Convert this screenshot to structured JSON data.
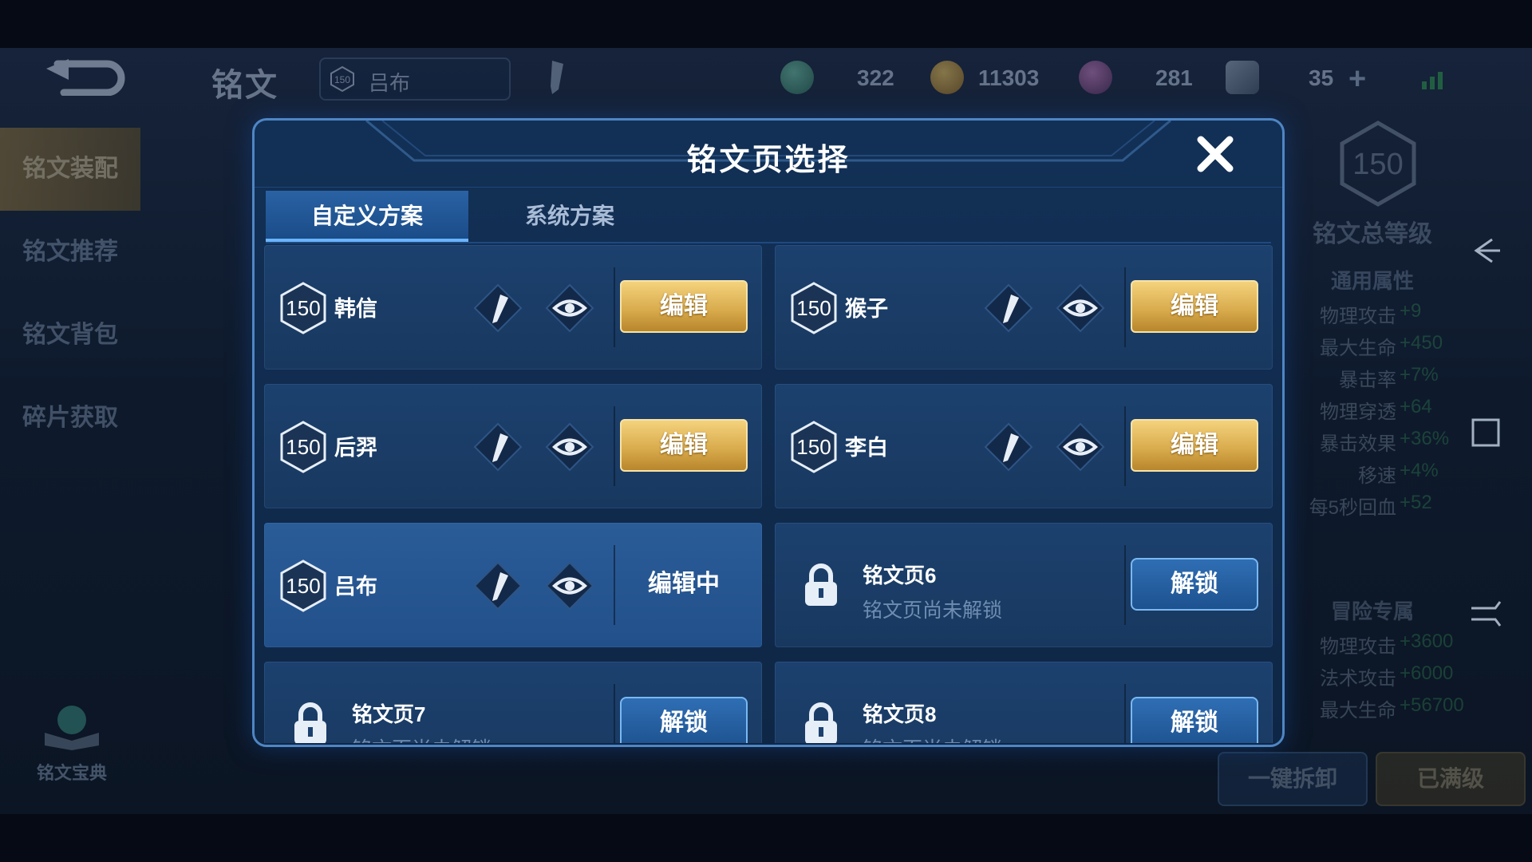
{
  "topbar": {
    "page_title": "铭文",
    "hero_level": "150",
    "hero_name": "吕布",
    "resources": [
      {
        "icon": "green-gem-icon",
        "value": "322"
      },
      {
        "icon": "gold-coin-icon",
        "value": "11303"
      },
      {
        "icon": "purple-crystal-icon",
        "value": "281"
      },
      {
        "icon": "shard-icon",
        "value": "35"
      }
    ],
    "plus_symbol": "+"
  },
  "leftnav": {
    "items": [
      {
        "label": "铭文装配",
        "active": true
      },
      {
        "label": "铭文推荐",
        "active": false
      },
      {
        "label": "铭文背包",
        "active": false
      },
      {
        "label": "碎片获取",
        "active": false
      }
    ],
    "book_label": "铭文宝典"
  },
  "rightpanel": {
    "total_level": "150",
    "total_label": "铭文总等级",
    "general_title": "通用属性",
    "general_attrs": [
      {
        "name": "物理攻击",
        "value": "+9"
      },
      {
        "name": "最大生命",
        "value": "+450"
      },
      {
        "name": "暴击率",
        "value": "+7%"
      },
      {
        "name": "物理穿透",
        "value": "+64"
      },
      {
        "name": "暴击效果",
        "value": "+36%"
      },
      {
        "name": "移速",
        "value": "+4%"
      },
      {
        "name": "每5秒回血",
        "value": "+52"
      }
    ],
    "adventure_title": "冒险专属",
    "adventure_attrs": [
      {
        "name": "物理攻击",
        "value": "+3600"
      },
      {
        "name": "法术攻击",
        "value": "+6000"
      },
      {
        "name": "最大生命",
        "value": "+56700"
      }
    ],
    "btn_remove_all": "一键拆卸",
    "btn_maxed": "已满级"
  },
  "modal": {
    "title": "铭文页选择",
    "tabs": [
      {
        "label": "自定义方案",
        "active": true
      },
      {
        "label": "系统方案",
        "active": false
      }
    ],
    "pages": [
      {
        "level": "150",
        "name": "韩信",
        "action": "编辑"
      },
      {
        "level": "150",
        "name": "猴子",
        "action": "编辑"
      },
      {
        "level": "150",
        "name": "后羿",
        "action": "编辑"
      },
      {
        "level": "150",
        "name": "李白",
        "action": "编辑"
      },
      {
        "level": "150",
        "name": "吕布",
        "action": "编辑中"
      },
      {
        "name": "铭文页6",
        "sub": "铭文页尚未解锁",
        "action": "解锁"
      },
      {
        "name": "铭文页7",
        "sub": "铭文页尚未解锁",
        "action": "解锁"
      },
      {
        "name": "铭文页8",
        "sub": "铭文页尚未解锁",
        "action": "解锁"
      }
    ]
  },
  "colors": {
    "gold_button": "#d7a94a",
    "modal_border": "#4f86c4",
    "unlock_button": "#1d528f",
    "stat_green": "#3ba35a"
  }
}
